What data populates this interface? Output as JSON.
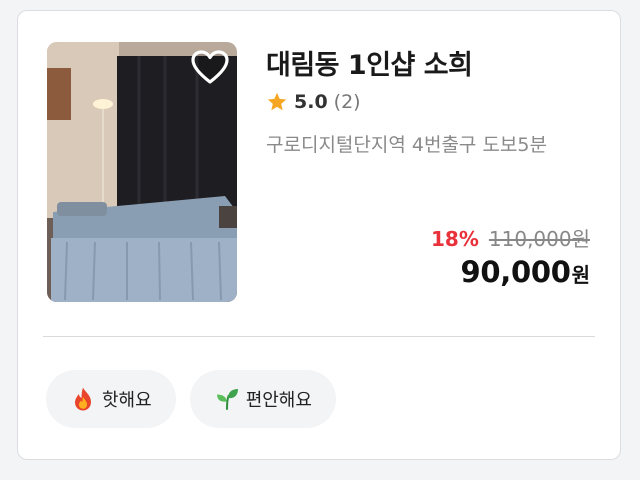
{
  "listing": {
    "title": "대림동 1인샵 소희",
    "rating": {
      "score": "5.0",
      "count": "(2)"
    },
    "location": "구로디지털단지역 4번출구 도보5분",
    "price": {
      "discount": "18%",
      "original": "110,000원",
      "final_amount": "90,000",
      "final_unit": "원"
    },
    "is_favorite": false,
    "tags": [
      {
        "label": "핫해요",
        "icon": "fire-icon"
      },
      {
        "label": "편안해요",
        "icon": "leaf-icon"
      }
    ]
  },
  "colors": {
    "discount": "#e8313a",
    "star": "#f5a623",
    "tag_background": "#f3f4f6"
  }
}
